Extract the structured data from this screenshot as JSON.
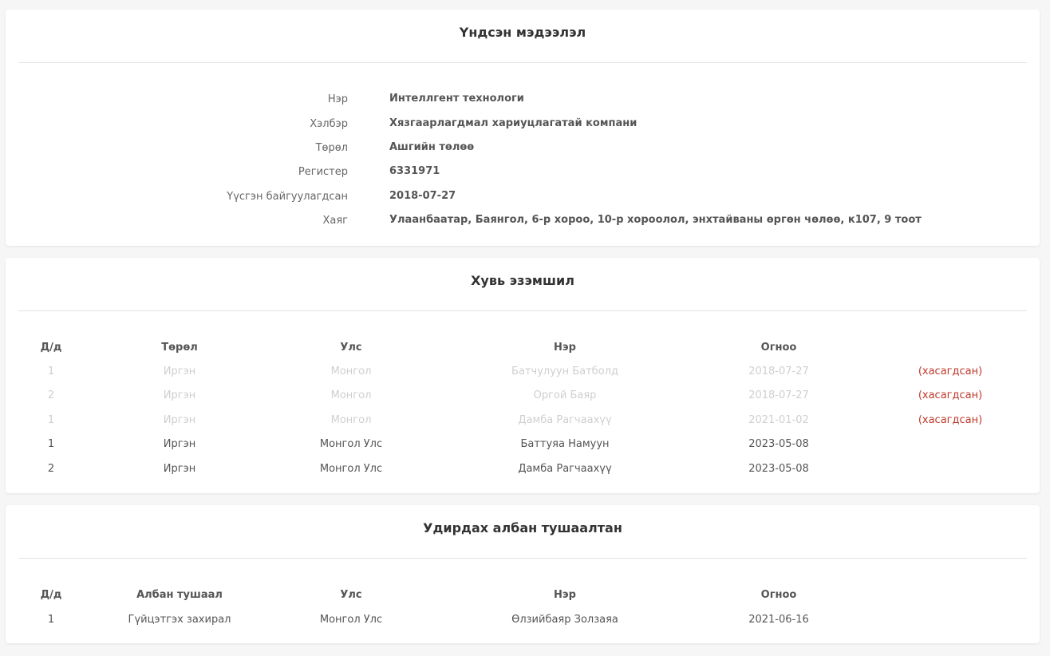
{
  "basic_info": {
    "title": "Үндсэн мэдээлэл",
    "rows": [
      {
        "label": "Нэр",
        "value": "Интеллгент технологи"
      },
      {
        "label": "Хэлбэр",
        "value": "Хязгаарлагдмал хариуцлагатай компани"
      },
      {
        "label": "Төрөл",
        "value": "Ашгийн төлөө"
      },
      {
        "label": "Регистер",
        "value": "6331971"
      },
      {
        "label": "Үүсгэн байгуулагдсан",
        "value": "2018-07-27"
      },
      {
        "label": "Хаяг",
        "value": "Улаанбаатар, Баянгол, 6-р хороо, 10-р хороолол, энхтайваны өргөн чөлөө, к107, 9 тоот"
      }
    ]
  },
  "ownership": {
    "title": "Хувь эзэмшил",
    "headers": [
      "Д/д",
      "Төрөл",
      "Улс",
      "Нэр",
      "Огноо"
    ],
    "rows": [
      {
        "no": "1",
        "type": "Иргэн",
        "country": "Монгол",
        "name": "Батчулуун Батболд",
        "date": "2018-07-27",
        "status": "(хасагдсан)"
      },
      {
        "no": "2",
        "type": "Иргэн",
        "country": "Монгол",
        "name": "Оргой Баяр",
        "date": "2018-07-27",
        "status": "(хасагдсан)"
      },
      {
        "no": "1",
        "type": "Иргэн",
        "country": "Монгол",
        "name": "Дамба Рагчаахүү",
        "date": "2021-01-02",
        "status": "(хасагдсан)"
      },
      {
        "no": "1",
        "type": "Иргэн",
        "country": "Монгол Улс",
        "name": "Баттуяа Намуун",
        "date": "2023-05-08",
        "status": ""
      },
      {
        "no": "2",
        "type": "Иргэн",
        "country": "Монгол Улс",
        "name": "Дамба Рагчаахүү",
        "date": "2023-05-08",
        "status": ""
      }
    ]
  },
  "officials": {
    "title": "Удирдах албан тушаалтан",
    "headers": [
      "Д/д",
      "Албан тушаал",
      "Улс",
      "Нэр",
      "Огноо"
    ],
    "rows": [
      {
        "no": "1",
        "position": "Гүйцэтгэх захирал",
        "country": "Монгол Улс",
        "name": "Өлзийбаяр Золзаяа",
        "date": "2021-06-16"
      }
    ]
  },
  "colors": {
    "removed_text": "#cfcfcf",
    "removed_flag": "#c0392b"
  }
}
